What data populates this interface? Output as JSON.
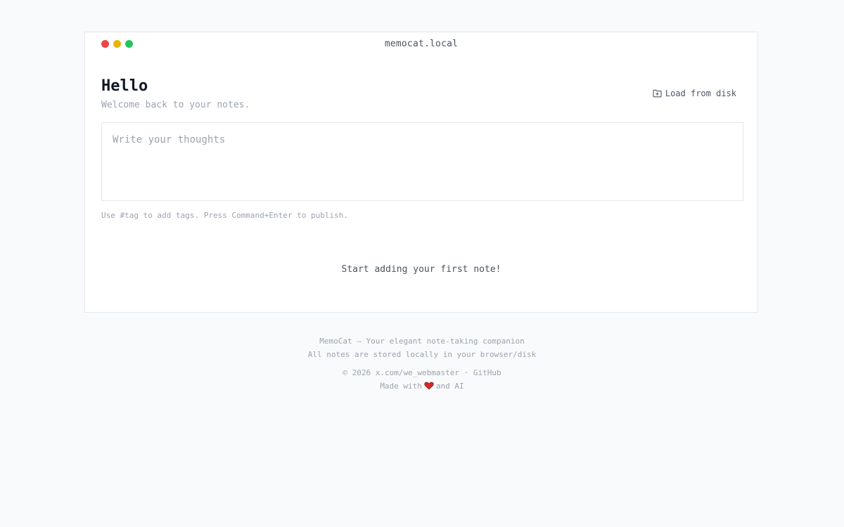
{
  "window": {
    "title": "memocat.local"
  },
  "header": {
    "greeting": "Hello",
    "subtitle": "Welcome back to your notes.",
    "load_label": "Load from disk"
  },
  "editor": {
    "placeholder": "Write your thoughts",
    "value": ""
  },
  "hint": "Use #tag to add tags. Press Command+Enter to publish.",
  "empty_state": "Start adding your first note!",
  "footer": {
    "line1": "MemoCat — Your elegant note-taking companion",
    "line2": "All notes are stored locally in your browser/disk",
    "copyright": "© 2026",
    "author_link": "x.com/we_webmaster",
    "separator": "·",
    "github_link": "GitHub",
    "made_with": "Made with",
    "and_ai": "and AI"
  },
  "icons": {
    "load": "folder-plus-icon",
    "heart": "heart-icon"
  },
  "colors": {
    "dot_red": "#ef4444",
    "dot_yellow": "#eab308",
    "dot_green": "#22c55e",
    "heart": "#dc2626"
  }
}
